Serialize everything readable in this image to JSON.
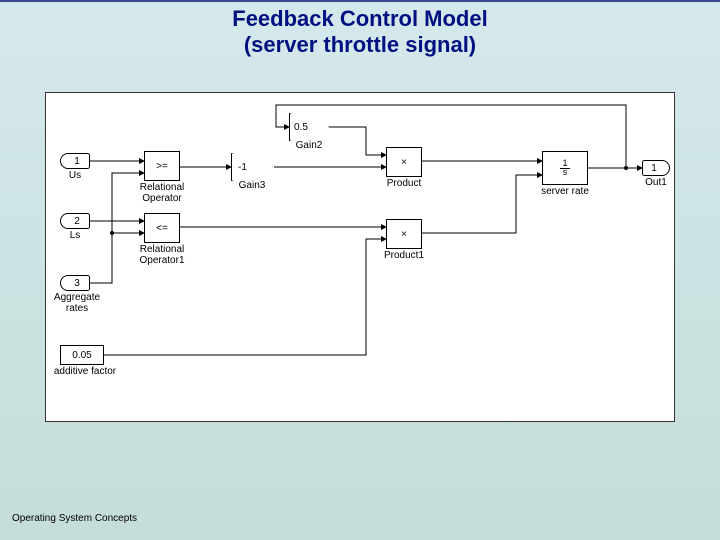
{
  "title_line1": "Feedback Control Model",
  "title_line2": "(server throttle signal)",
  "footer": "Operating System Concepts",
  "ports": {
    "in1": {
      "num": "1",
      "label": "Us"
    },
    "in2": {
      "num": "2",
      "label": "Ls"
    },
    "in3": {
      "num": "3",
      "label": "Aggregate\nrates"
    },
    "const": {
      "val": "0.05",
      "label": "additive factor"
    },
    "out1": {
      "num": "1",
      "label": "Out1"
    }
  },
  "blocks": {
    "relop1": {
      "op": ">=",
      "label": "Relational\nOperator"
    },
    "relop2": {
      "op": "<=",
      "label": "Relational\nOperator1"
    },
    "gain2": {
      "val": "0.5",
      "label": "Gain2"
    },
    "gain3": {
      "val": "-1",
      "label": "Gain3"
    },
    "prod1": {
      "sym": "×",
      "label": "Product"
    },
    "prod2": {
      "sym": "×",
      "label": "Product1"
    },
    "integrator": {
      "num": "1",
      "den": "s",
      "label": "server rate"
    }
  }
}
